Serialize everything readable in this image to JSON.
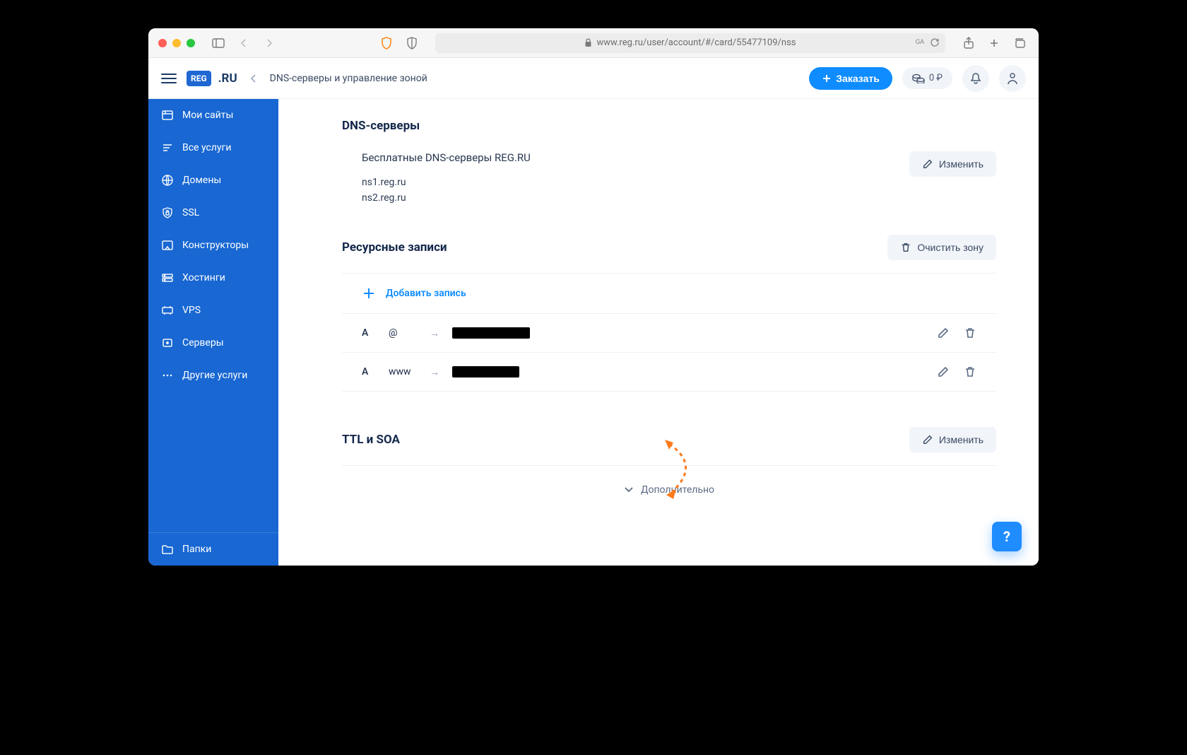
{
  "browser": {
    "url": "www.reg.ru/user/account/#/card/55477109/nss"
  },
  "header": {
    "logo_badge": "REG",
    "logo_suffix": ".RU",
    "breadcrumb": "DNS-серверы и управление зоной",
    "order_label": "Заказать",
    "balance": "0 ₽"
  },
  "sidebar": {
    "items": [
      {
        "label": "Мои сайты"
      },
      {
        "label": "Все услуги"
      },
      {
        "label": "Домены"
      },
      {
        "label": "SSL"
      },
      {
        "label": "Конструкторы"
      },
      {
        "label": "Хостинги"
      },
      {
        "label": "VPS"
      },
      {
        "label": "Серверы"
      },
      {
        "label": "Другие услуги"
      }
    ],
    "footer_label": "Папки"
  },
  "dns": {
    "section_title": "DNS-серверы",
    "subtitle": "Бесплатные DNS-серверы REG.RU",
    "ns1": "ns1.reg.ru",
    "ns2": "ns2.reg.ru",
    "edit_label": "Изменить"
  },
  "rr": {
    "section_title": "Ресурсные записи",
    "clear_label": "Очистить зону",
    "add_label": "Добавить запись",
    "rows": [
      {
        "type": "A",
        "host": "@"
      },
      {
        "type": "A",
        "host": "www"
      }
    ]
  },
  "ttl": {
    "title": "TTL и SOA",
    "edit_label": "Изменить"
  },
  "footer": {
    "expand_label": "Дополнительно"
  },
  "help": "?"
}
